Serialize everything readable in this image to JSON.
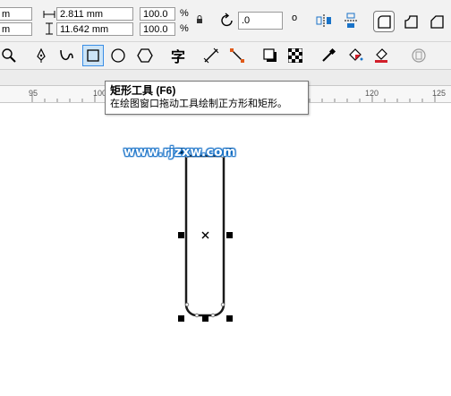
{
  "property_bar": {
    "x_partial": "m",
    "y_partial": "m",
    "width_value": "2.811 mm",
    "height_value": "11.642 mm",
    "scale_x": "100.0",
    "scale_y": "100.0",
    "percent_a": "%",
    "percent_b": "%",
    "rotation_value": ".0",
    "degree_symbol": "o"
  },
  "toolbox": {
    "active_tool": "rectangle-tool"
  },
  "ruler": {
    "labels": [
      "95",
      "100",
      "120",
      "125"
    ]
  },
  "tooltip": {
    "title": "矩形工具 (F6)",
    "description": "在绘图窗口拖动工具绘制正方形和矩形。"
  },
  "canvas": {
    "watermark": "www.rjzxw.com"
  },
  "colors": {
    "panel_bg": "#f2f2f2",
    "accent_blue": "#1a73c8",
    "active_tool_bg": "#cce4f7"
  }
}
